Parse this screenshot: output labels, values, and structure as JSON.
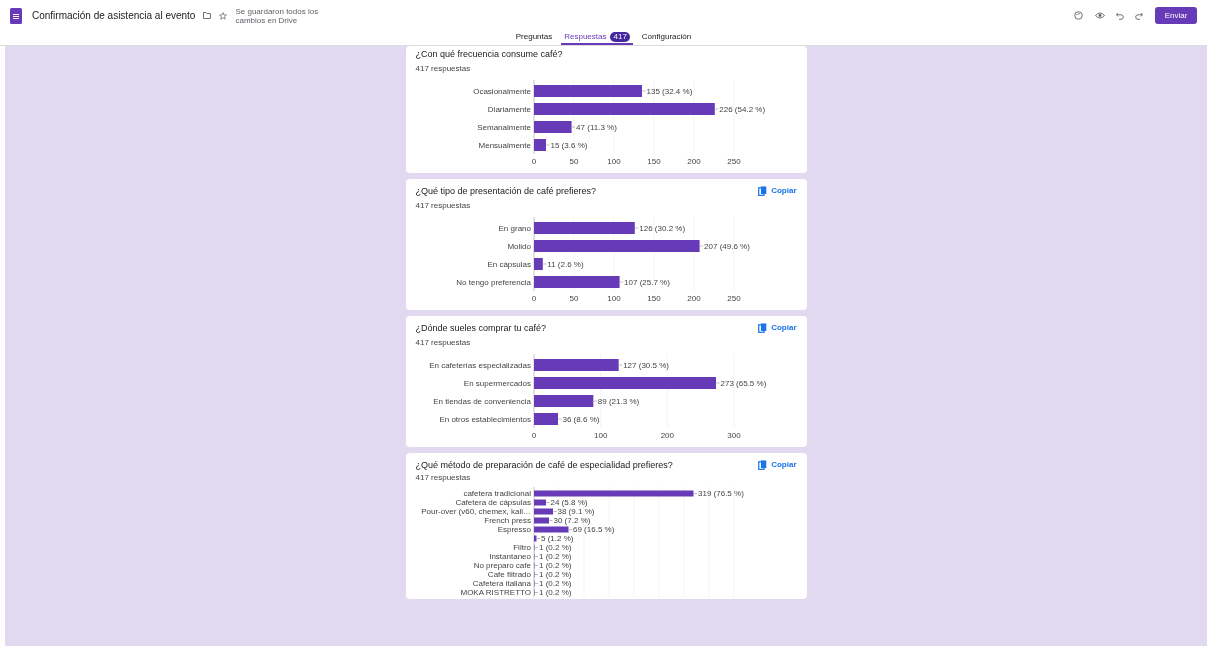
{
  "header": {
    "title": "Confirmación de asistencia al evento",
    "save_status": "Se guardaron todos los cambios en Drive",
    "send_button": "Enviar"
  },
  "tabs": [
    {
      "label": "Preguntas",
      "selected": false
    },
    {
      "label": "Respuestas",
      "selected": true,
      "badge": "417"
    },
    {
      "label": "Configuración",
      "selected": false
    }
  ],
  "cards": [
    {
      "title": "¿Con qué frecuencia consume café?",
      "responses": "417 respuestas",
      "chart_data": {
        "type": "bar",
        "orientation": "horizontal",
        "categories": [
          "Ocasionalmente",
          "Diariamente",
          "Semanalmente",
          "Mensualmente"
        ],
        "values": [
          135,
          226,
          47,
          15
        ],
        "grid": true,
        "xlim": [
          0,
          250
        ],
        "xticks": [
          0,
          50,
          100,
          150,
          200,
          250
        ],
        "value_labels": [
          "135 (32.4 %)",
          "226 (54.2 %)",
          "47 (11.3 %)",
          "15 (3.6 %)"
        ]
      }
    },
    {
      "title": "¿Qué tipo de presentación de café prefieres?",
      "responses": "417 respuestas",
      "copy": "Copiar",
      "chart_data": {
        "type": "bar",
        "orientation": "horizontal",
        "categories": [
          "En grano",
          "Molido",
          "En cápsulas",
          "No tengo preferencia"
        ],
        "values": [
          126,
          207,
          11,
          107
        ],
        "grid": true,
        "xlim": [
          0,
          250
        ],
        "xticks": [
          0,
          50,
          100,
          150,
          200,
          250
        ],
        "value_labels": [
          "126 (30.2 %)",
          "207 (49.6 %)",
          "11 (2.6 %)",
          "107 (25.7 %)"
        ]
      }
    },
    {
      "title": "¿Dónde sueles comprar tu café?",
      "responses": "417 respuestas",
      "copy": "Copiar",
      "chart_data": {
        "type": "bar",
        "orientation": "horizontal",
        "categories": [
          "En cafeterías especializadas",
          "En supermercados",
          "En tiendas de conveniencia",
          "En otros establecimientos"
        ],
        "values": [
          127,
          273,
          89,
          36
        ],
        "grid": true,
        "xlim": [
          0,
          300
        ],
        "xticks": [
          0,
          100,
          200,
          300
        ],
        "value_labels": [
          "127 (30.5 %)",
          "273 (65.5 %)",
          "89 (21.3 %)",
          "36 (8.6 %)"
        ]
      }
    },
    {
      "title": "¿Qué método de preparación de café de especialidad prefieres?",
      "responses": "417 respuestas",
      "copy": "Copiar",
      "chart_data": {
        "type": "bar",
        "orientation": "horizontal",
        "categories": [
          "cafetera tradicional",
          "Cafetera de cápsulas",
          "Pour-over (v60, chemex, kali…",
          "French press",
          "Espresso",
          null,
          "Filtro",
          "Instantaneo",
          "No preparo cafe",
          "Cafe filtrado",
          "Cafetera italiana",
          "MOKA RISTRETTO"
        ],
        "values": [
          319,
          24,
          38,
          30,
          69,
          5,
          1,
          1,
          1,
          1,
          1,
          1
        ],
        "grid": true,
        "xlim": [
          0,
          400
        ],
        "value_labels": [
          "319 (76.5 %)",
          "24 (5.8 %)",
          "38 (9.1 %)",
          "30 (7.2 %)",
          "69 (16.5 %)",
          "5 (1.2 %)",
          "1 (0.2 %)",
          "1 (0.2 %)",
          "1 (0.2 %)",
          "1 (0.2 %)",
          "1 (0.2 %)",
          "1 (0.2 %)"
        ]
      }
    }
  ]
}
